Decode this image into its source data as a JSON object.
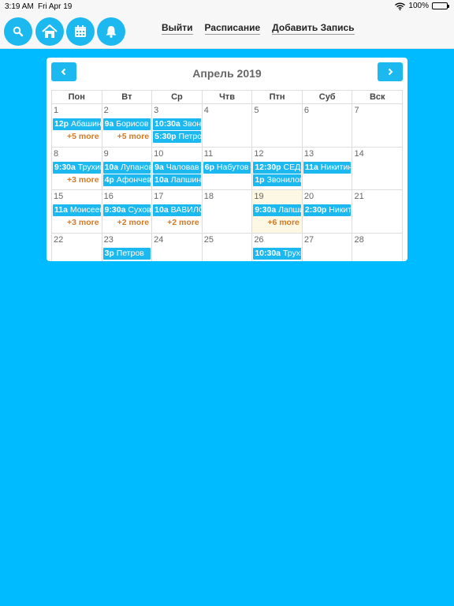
{
  "status_bar": {
    "time": "3:19 AM",
    "date": "Fri Apr 19",
    "battery": "100%"
  },
  "nav": {
    "icons": [
      "search-icon",
      "home-icon",
      "calendar-icon",
      "bell-icon"
    ],
    "links": [
      "Выйти",
      "Расписание",
      "Добавить Запись"
    ]
  },
  "calendar": {
    "title": "Апрель 2019",
    "weekdays": [
      "Пон",
      "Вт",
      "Ср",
      "Чтв",
      "Птн",
      "Суб",
      "Вск"
    ],
    "weeks": [
      [
        {
          "day": "1",
          "events": [
            {
              "time": "12p",
              "title": "Абашин"
            }
          ],
          "more": "+5 more"
        },
        {
          "day": "2",
          "events": [
            {
              "time": "9a",
              "title": "Борисов"
            }
          ],
          "more": "+5 more"
        },
        {
          "day": "3",
          "events": [
            {
              "time": "10:30a",
              "title": "Звонилов"
            },
            {
              "time": "5:30p",
              "title": "Петров"
            }
          ],
          "more": ""
        },
        {
          "day": "4",
          "events": [],
          "more": ""
        },
        {
          "day": "5",
          "events": [],
          "more": ""
        },
        {
          "day": "6",
          "events": [],
          "more": ""
        },
        {
          "day": "7",
          "events": [],
          "more": ""
        }
      ],
      [
        {
          "day": "8",
          "events": [
            {
              "time": "9:30a",
              "title": "Трухин"
            }
          ],
          "more": "+3 more"
        },
        {
          "day": "9",
          "events": [
            {
              "time": "10a",
              "title": "Лупанов"
            },
            {
              "time": "4p",
              "title": "Афончев"
            }
          ],
          "more": ""
        },
        {
          "day": "10",
          "events": [
            {
              "time": "9a",
              "title": "Чаловав"
            },
            {
              "time": "10a",
              "title": "Лапшин"
            }
          ],
          "more": ""
        },
        {
          "day": "11",
          "events": [
            {
              "time": "6p",
              "title": "Набутов"
            }
          ],
          "more": ""
        },
        {
          "day": "12",
          "events": [
            {
              "time": "12:30p",
              "title": "СЕДОВ"
            },
            {
              "time": "1p",
              "title": "Звонилов"
            }
          ],
          "more": ""
        },
        {
          "day": "13",
          "events": [
            {
              "time": "11a",
              "title": "Никитин"
            }
          ],
          "more": ""
        },
        {
          "day": "14",
          "events": [],
          "more": ""
        }
      ],
      [
        {
          "day": "15",
          "events": [
            {
              "time": "11a",
              "title": "Моисеев"
            }
          ],
          "more": "+3 more"
        },
        {
          "day": "16",
          "events": [
            {
              "time": "9:30a",
              "title": "Сухов"
            }
          ],
          "more": "+2 more"
        },
        {
          "day": "17",
          "events": [
            {
              "time": "10a",
              "title": "ВАВИЛОВ"
            }
          ],
          "more": "+2 more"
        },
        {
          "day": "18",
          "events": [],
          "more": ""
        },
        {
          "day": "19",
          "today": true,
          "events": [
            {
              "time": "9:30a",
              "title": "Лапшин"
            }
          ],
          "more": "+6 more"
        },
        {
          "day": "20",
          "events": [
            {
              "time": "2:30p",
              "title": "Никитин"
            }
          ],
          "more": ""
        },
        {
          "day": "21",
          "events": [],
          "more": ""
        }
      ],
      [
        {
          "day": "22",
          "events": [],
          "more": ""
        },
        {
          "day": "23",
          "events": [
            {
              "time": "3p",
              "title": "Петров"
            }
          ],
          "more": ""
        },
        {
          "day": "24",
          "events": [],
          "more": ""
        },
        {
          "day": "25",
          "events": [],
          "more": ""
        },
        {
          "day": "26",
          "events": [
            {
              "time": "10:30a",
              "title": "Трухин"
            }
          ],
          "more": ""
        },
        {
          "day": "27",
          "events": [],
          "more": ""
        },
        {
          "day": "28",
          "events": [],
          "more": ""
        }
      ]
    ]
  }
}
